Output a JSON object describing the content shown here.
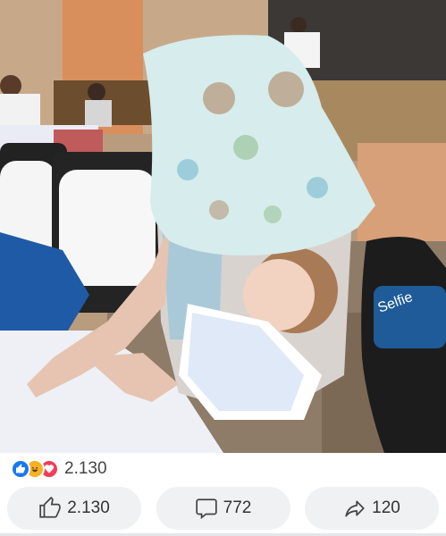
{
  "post": {
    "photo": {
      "logo_text": "Selfie",
      "colors": {
        "wall": "#c9a27a",
        "tablecloth": "#eef0f6",
        "blanket": "#d7ecec",
        "chair": "#2a2a2a"
      }
    },
    "reactions": {
      "icons": [
        "like-icon",
        "haha-icon",
        "love-icon"
      ],
      "count": "2.130"
    },
    "actions": {
      "like_count": "2.130",
      "comment_count": "772",
      "share_count": "120"
    }
  }
}
